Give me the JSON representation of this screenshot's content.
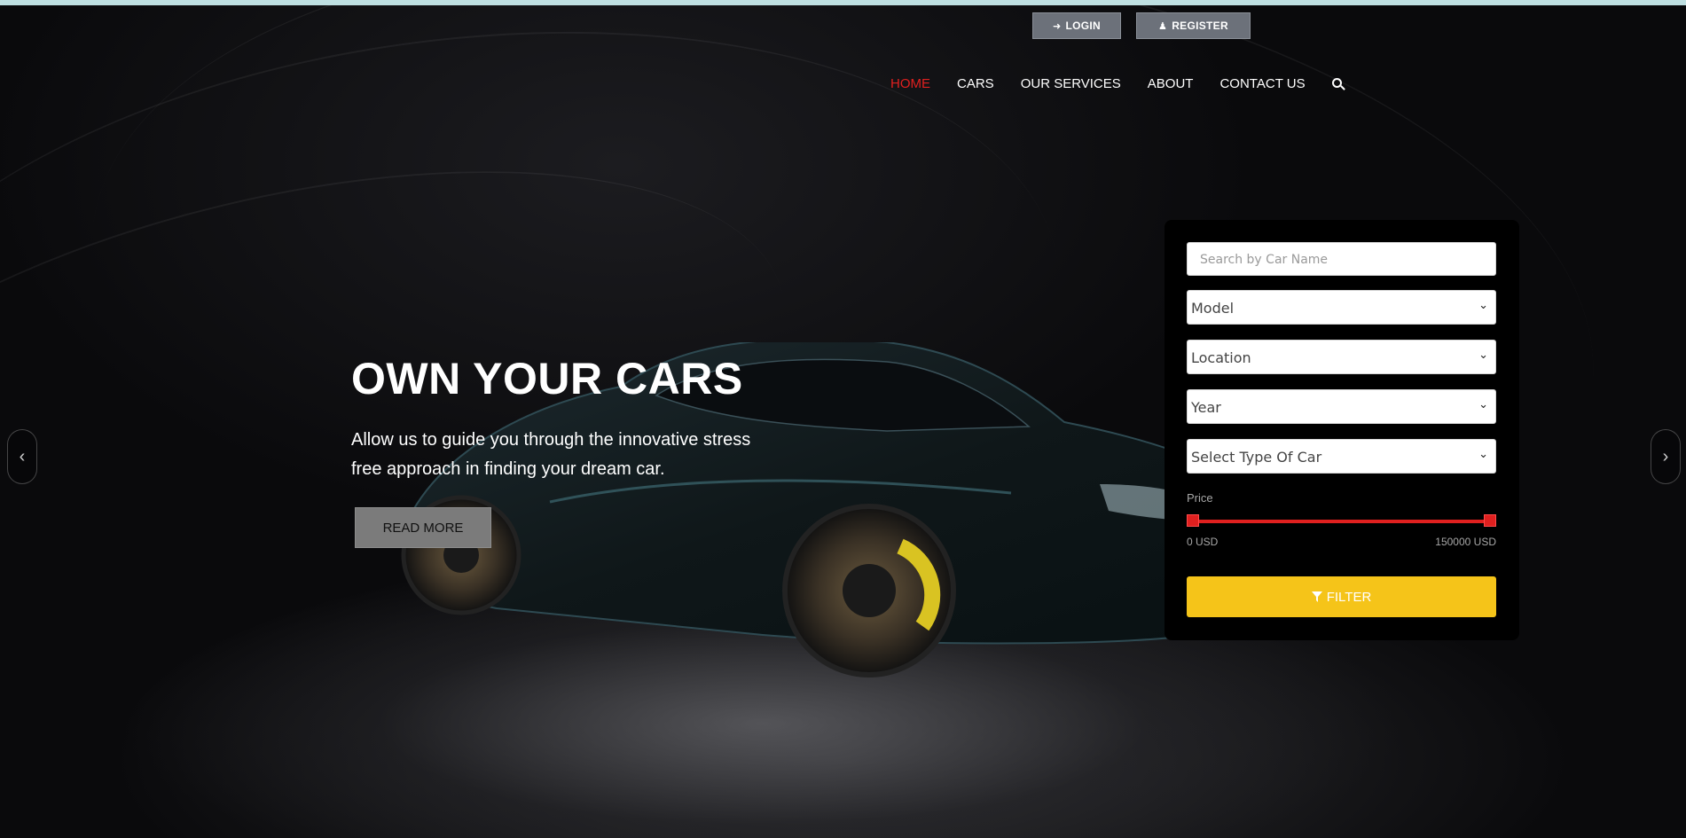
{
  "auth": {
    "login_label": "LOGIN",
    "register_label": "REGISTER"
  },
  "nav": {
    "items": [
      {
        "label": "HOME",
        "active": true
      },
      {
        "label": "CARS",
        "active": false
      },
      {
        "label": "OUR SERVICES",
        "active": false
      },
      {
        "label": "ABOUT",
        "active": false
      },
      {
        "label": "CONTACT US",
        "active": false
      }
    ],
    "search_icon": "search-icon"
  },
  "hero": {
    "title": "OWN YOUR CARS",
    "subtitle": "Allow us to guide you through the innovative stress free approach in finding your dream car.",
    "cta_label": "READ MORE",
    "prev_arrow": "‹",
    "next_arrow": "›"
  },
  "filter": {
    "search_placeholder": "Search by Car Name",
    "model": "Model",
    "location": "Location",
    "year": "Year",
    "car_type": "Select Type Of Car",
    "price_label": "Price",
    "price_min": "0 USD",
    "price_max": "150000 USD",
    "button_label": "FILTER"
  },
  "colors": {
    "accent_red": "#e0201f",
    "filter_yellow": "#f5c419",
    "auth_gray": "#6c717a"
  }
}
